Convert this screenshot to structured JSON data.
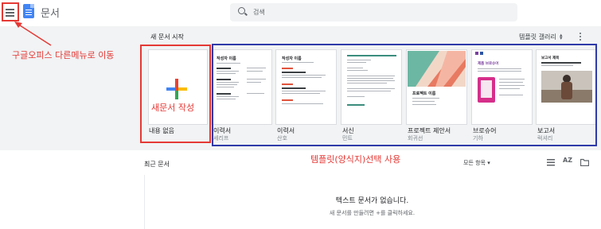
{
  "header": {
    "title": "문서",
    "search_placeholder": "검색"
  },
  "gallery": {
    "heading": "새 문서 시작",
    "link_label": "템플릿 갤러리",
    "templates": [
      {
        "name": "내용 없음",
        "sub": ""
      },
      {
        "name": "이력서",
        "sub": "세리프"
      },
      {
        "name": "이력서",
        "sub": "산호"
      },
      {
        "name": "서신",
        "sub": "민트"
      },
      {
        "name": "프로젝트 제안서",
        "sub": "회귀선"
      },
      {
        "name": "브로슈어",
        "sub": "기하"
      },
      {
        "name": "보고서",
        "sub": "럭셔리"
      }
    ],
    "thumb_texts": {
      "resume_name": "작성자 이름",
      "proposal_title": "프로젝트 이름",
      "brochure_title": "제품 브로슈어",
      "report_title": "보고서 제목"
    }
  },
  "recent": {
    "heading": "최근 문서",
    "owner_filter": "모든 항목",
    "empty_title": "텍스트 문서가 없습니다.",
    "empty_sub": "새 문서를 만들려면 +를 클릭하세요."
  },
  "annotations": {
    "menu_note": "구글오피스 다른메뉴로 이동",
    "blank_note": "새문서 작성",
    "template_note": "템플릿(양식지)선택 사용"
  },
  "colors": {
    "annotation_red": "#e53935",
    "annotation_blue": "#2f3aa8",
    "docs_blue": "#4285f4"
  }
}
